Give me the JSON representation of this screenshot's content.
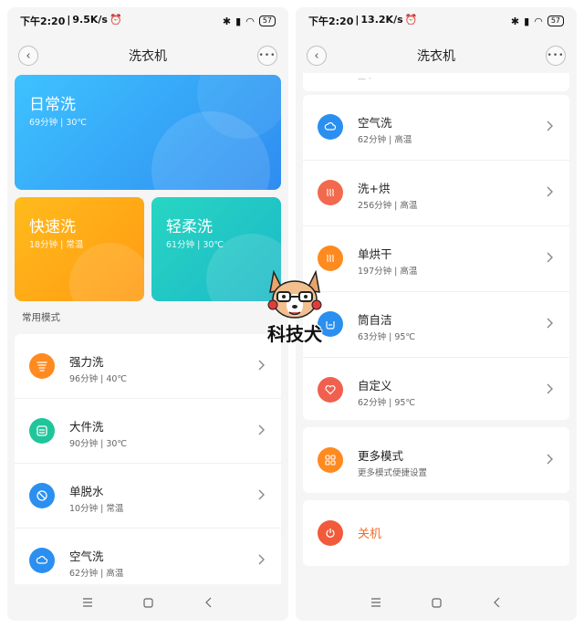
{
  "left": {
    "status": {
      "time": "下午2:20",
      "speed": "9.5K/s",
      "battery": "57"
    },
    "title": "洗衣机",
    "hero": {
      "daily": {
        "name": "日常洗",
        "meta": "69分钟 | 30℃"
      },
      "quick": {
        "name": "快速洗",
        "meta": "18分钟 | 常温"
      },
      "gentle": {
        "name": "轻柔洗",
        "meta": "61分钟 | 30℃"
      }
    },
    "section_label": "常用模式",
    "modes": [
      {
        "name": "强力洗",
        "meta": "96分钟 | 40℃",
        "icon": "strong-wash-icon",
        "color": "#ff8a1f"
      },
      {
        "name": "大件洗",
        "meta": "90分钟 | 30℃",
        "icon": "bulky-wash-icon",
        "color": "#21c59b"
      },
      {
        "name": "单脱水",
        "meta": "10分钟 | 常温",
        "icon": "spin-icon",
        "color": "#2b8ff0"
      },
      {
        "name": "空气洗",
        "meta": "62分钟 | 高温",
        "icon": "air-wash-icon",
        "color": "#2b8ff0"
      }
    ]
  },
  "right": {
    "status": {
      "time": "下午2:20",
      "speed": "13.2K/s",
      "battery": "57"
    },
    "title": "洗衣机",
    "modes": [
      {
        "name": "空气洗",
        "meta": "62分钟 | 高温",
        "icon": "air-wash-icon",
        "color": "#2b8ff0"
      },
      {
        "name": "洗+烘",
        "meta": "256分钟 | 高温",
        "icon": "wash-dry-icon",
        "color": "#f16a4d"
      },
      {
        "name": "单烘干",
        "meta": "197分钟 | 高温",
        "icon": "dry-icon",
        "color": "#ff8a1f"
      },
      {
        "name": "筒自洁",
        "meta": "63分钟 | 95℃",
        "icon": "drum-clean-icon",
        "color": "#2b8ff0"
      },
      {
        "name": "自定义",
        "meta": "62分钟 | 95℃",
        "icon": "custom-heart-icon",
        "color": "#f1604f"
      }
    ],
    "more": {
      "name": "更多模式",
      "meta": "更多模式便捷设置",
      "icon": "grid-icon",
      "color": "#ff8a1f"
    },
    "power": {
      "label": "关机",
      "icon": "power-icon",
      "color": "#f15a3a"
    }
  },
  "watermark": {
    "text": "科技犬"
  }
}
